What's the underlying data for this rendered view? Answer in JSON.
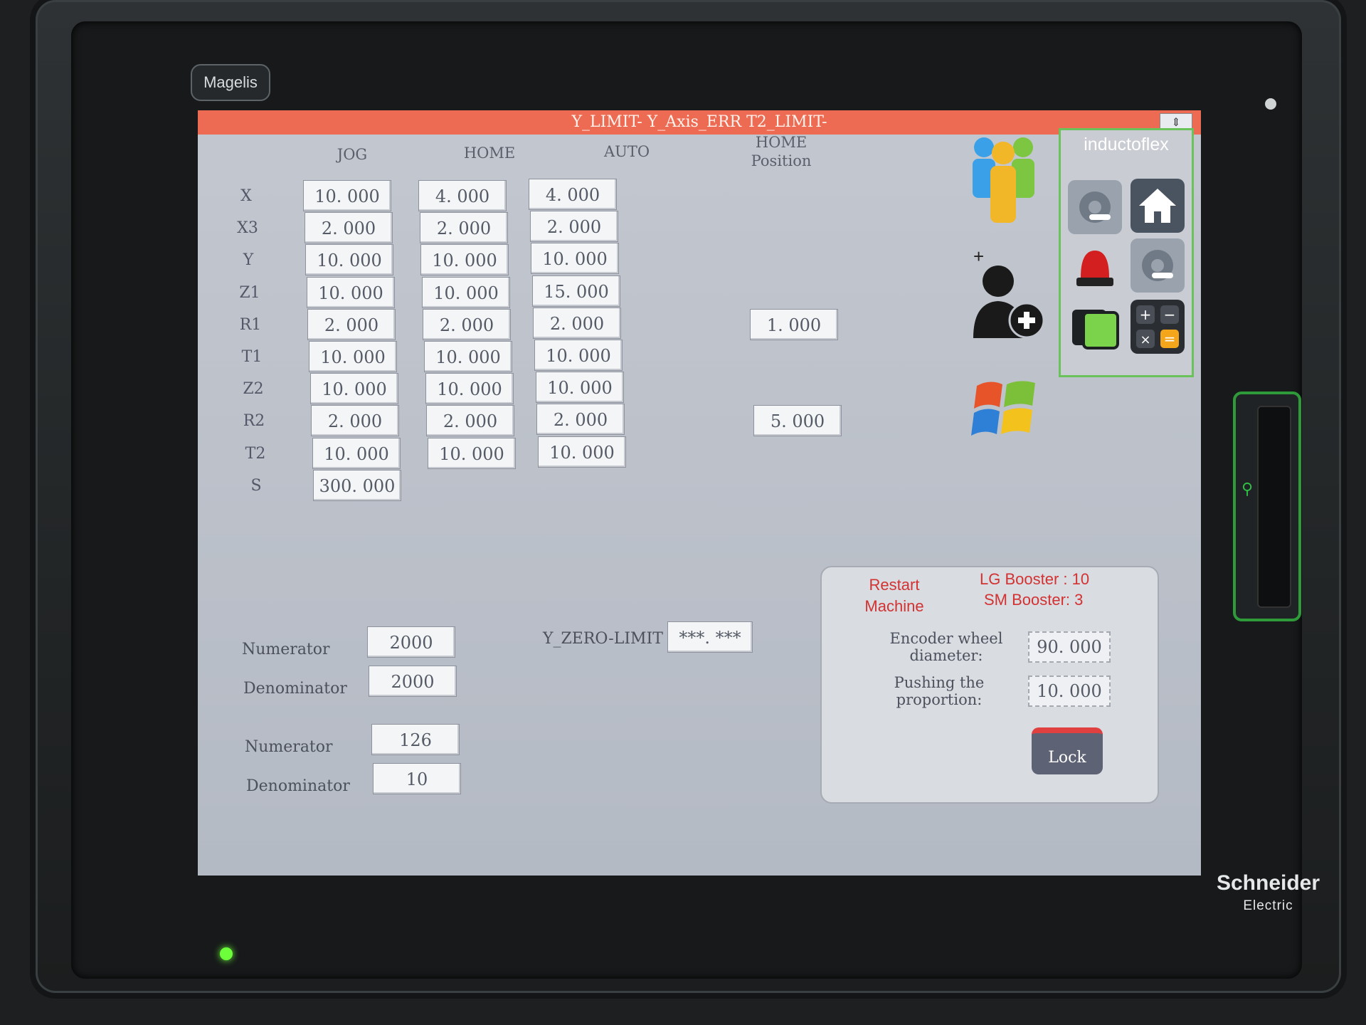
{
  "device": {
    "model_badge": "Magelis",
    "brand_line1": "Schneider",
    "brand_line2": "Electric"
  },
  "alarm_bar": {
    "text": "Y_LIMIT-  Y_Axis_ERR  T2_LIMIT-",
    "collapse_symbol": "⇕",
    "color": "#ec6b52"
  },
  "table": {
    "columns": [
      "JOG",
      "HOME",
      "AUTO"
    ],
    "home_position_header_line1": "HOME",
    "home_position_header_line2": "Position",
    "rows": [
      {
        "label": "X",
        "jog": "10. 000",
        "home": "4. 000",
        "auto": "4. 000",
        "home_position": ""
      },
      {
        "label": "X3",
        "jog": "2. 000",
        "home": "2. 000",
        "auto": "2. 000",
        "home_position": ""
      },
      {
        "label": "Y",
        "jog": "10. 000",
        "home": "10. 000",
        "auto": "10. 000",
        "home_position": ""
      },
      {
        "label": "Z1",
        "jog": "10. 000",
        "home": "10. 000",
        "auto": "15. 000",
        "home_position": ""
      },
      {
        "label": "R1",
        "jog": "2. 000",
        "home": "2. 000",
        "auto": "2. 000",
        "home_position": "1. 000"
      },
      {
        "label": "T1",
        "jog": "10. 000",
        "home": "10. 000",
        "auto": "10. 000",
        "home_position": ""
      },
      {
        "label": "Z2",
        "jog": "10. 000",
        "home": "10. 000",
        "auto": "10. 000",
        "home_position": ""
      },
      {
        "label": "R2",
        "jog": "2. 000",
        "home": "2. 000",
        "auto": "2. 000",
        "home_position": "5. 000"
      },
      {
        "label": "T2",
        "jog": "10. 000",
        "home": "10. 000",
        "auto": "10. 000",
        "home_position": ""
      },
      {
        "label": "S",
        "jog": "300. 000",
        "home": "",
        "auto": "",
        "home_position": ""
      }
    ]
  },
  "ratios": [
    {
      "numerator_label": "Numerator",
      "numerator": "2000",
      "denominator_label": "Denominator",
      "denominator": "2000"
    },
    {
      "numerator_label": "Numerator",
      "numerator": "126",
      "denominator_label": "Denominator",
      "denominator": "10"
    }
  ],
  "y_zero_limit": {
    "label": "Y_ZERO-LIMIT",
    "value": "***. ***"
  },
  "machine_panel": {
    "restart_line1": "Restart",
    "restart_line2": "Machine",
    "lg_booster": "LG Booster : 10",
    "sm_booster": "SM Booster:  3",
    "encoder_label_line1": "Encoder wheel",
    "encoder_label_line2": "diameter:",
    "encoder_value": "90. 000",
    "pushing_label_line1": "Pushing the",
    "pushing_label_line2": "proportion:",
    "pushing_value": "10. 000",
    "lock_label": "Lock"
  },
  "side_menu": {
    "brand": "inductoflex",
    "icons": [
      "users-group-icon",
      "add-user-icon",
      "windows-icon",
      "settings-gear-icon",
      "home-icon",
      "alarm-siren-icon",
      "settings-gear-2-icon",
      "switch-screen-icon",
      "calculator-icon"
    ],
    "add_user_plus": "+"
  }
}
